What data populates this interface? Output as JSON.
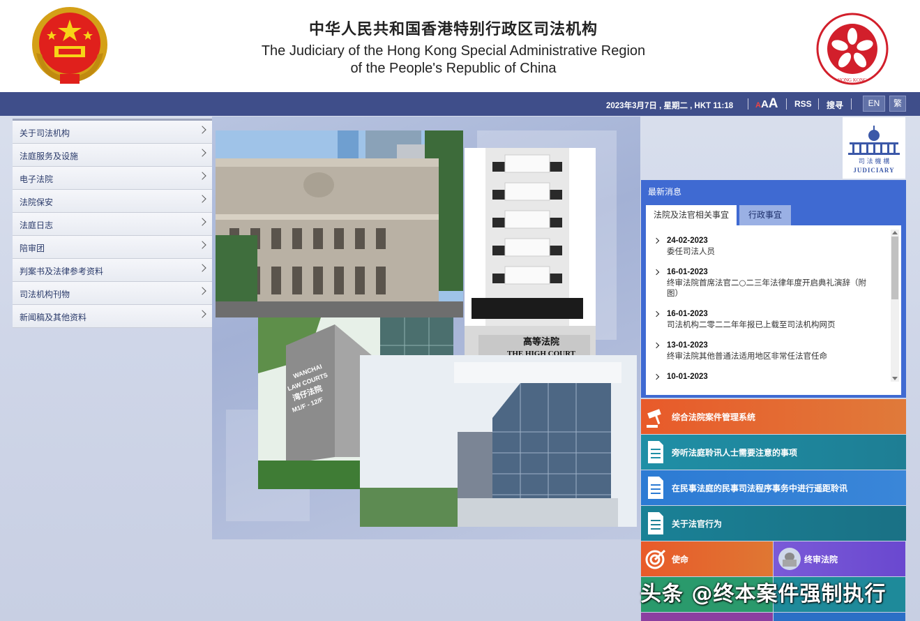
{
  "header": {
    "title_zh": "中华人民共和国香港特别行政区司法机构",
    "title_en_line1": "The Judiciary of the Hong Kong Special Administrative Region",
    "title_en_line2": "of the People's Republic of China",
    "hk_emblem_text": "HONG KONG"
  },
  "topbar": {
    "datetime": "2023年3月7日 , 星期二 , HKT 11:18",
    "font_size_small": "A",
    "font_size_medium": "A",
    "font_size_large": "A",
    "rss": "RSS",
    "search": "搜寻",
    "lang_en": "EN",
    "lang_tc": "繁"
  },
  "left_menu": {
    "items": [
      {
        "label": "关于司法机构"
      },
      {
        "label": "法庭服务及设施"
      },
      {
        "label": "电子法院"
      },
      {
        "label": "法院保安"
      },
      {
        "label": "法庭日志"
      },
      {
        "label": "陪审团"
      },
      {
        "label": "判案书及法律参考资料"
      },
      {
        "label": "司法机构刊物"
      },
      {
        "label": "新闻稿及其他资料"
      }
    ]
  },
  "banner": {
    "high_court_sign_zh": "高等法院",
    "high_court_sign_en": "THE HIGH COURT",
    "wanchai_sign_line1": "WANCHAI",
    "wanchai_sign_line2": "LAW COURTS",
    "wanchai_sign_line3": "湾仔法院",
    "wanchai_sign_line4": "M1/F - 12/F"
  },
  "judiciary_logo": {
    "zh": "司 法 機 構",
    "en": "JUDICIARY"
  },
  "news": {
    "title": "最新消息",
    "tabs": [
      {
        "label": "法院及法官相关事宜"
      },
      {
        "label": "行政事宜"
      }
    ],
    "items": [
      {
        "date": "24-02-2023",
        "text": "委任司法人员"
      },
      {
        "date": "16-01-2023",
        "text": "终审法院首席法官二○二三年法律年度开启典礼演辞（附图）"
      },
      {
        "date": "16-01-2023",
        "text": "司法机构二零二二年年报已上载至司法机构网页"
      },
      {
        "date": "13-01-2023",
        "text": "终审法院其他普通法适用地区非常任法官任命"
      },
      {
        "date": "10-01-2023",
        "text": ""
      }
    ]
  },
  "quick_links": [
    {
      "label": "综合法院案件管理系统",
      "color": "#e0632f"
    },
    {
      "label": "旁听法庭聆讯人士需要注意的事项",
      "color": "#1f8aa8"
    },
    {
      "label": "在民事法庭的民事司法程序事务中进行遥距聆讯",
      "color": "#2f78cf"
    },
    {
      "label": "关于法官行为",
      "color": "#1a7f95"
    }
  ],
  "tiles": [
    {
      "label": "使命",
      "color": "#e35a2c"
    },
    {
      "label": "终审法院",
      "color": "#7458d6"
    }
  ],
  "watermark": "头条 @终本案件强制执行"
}
